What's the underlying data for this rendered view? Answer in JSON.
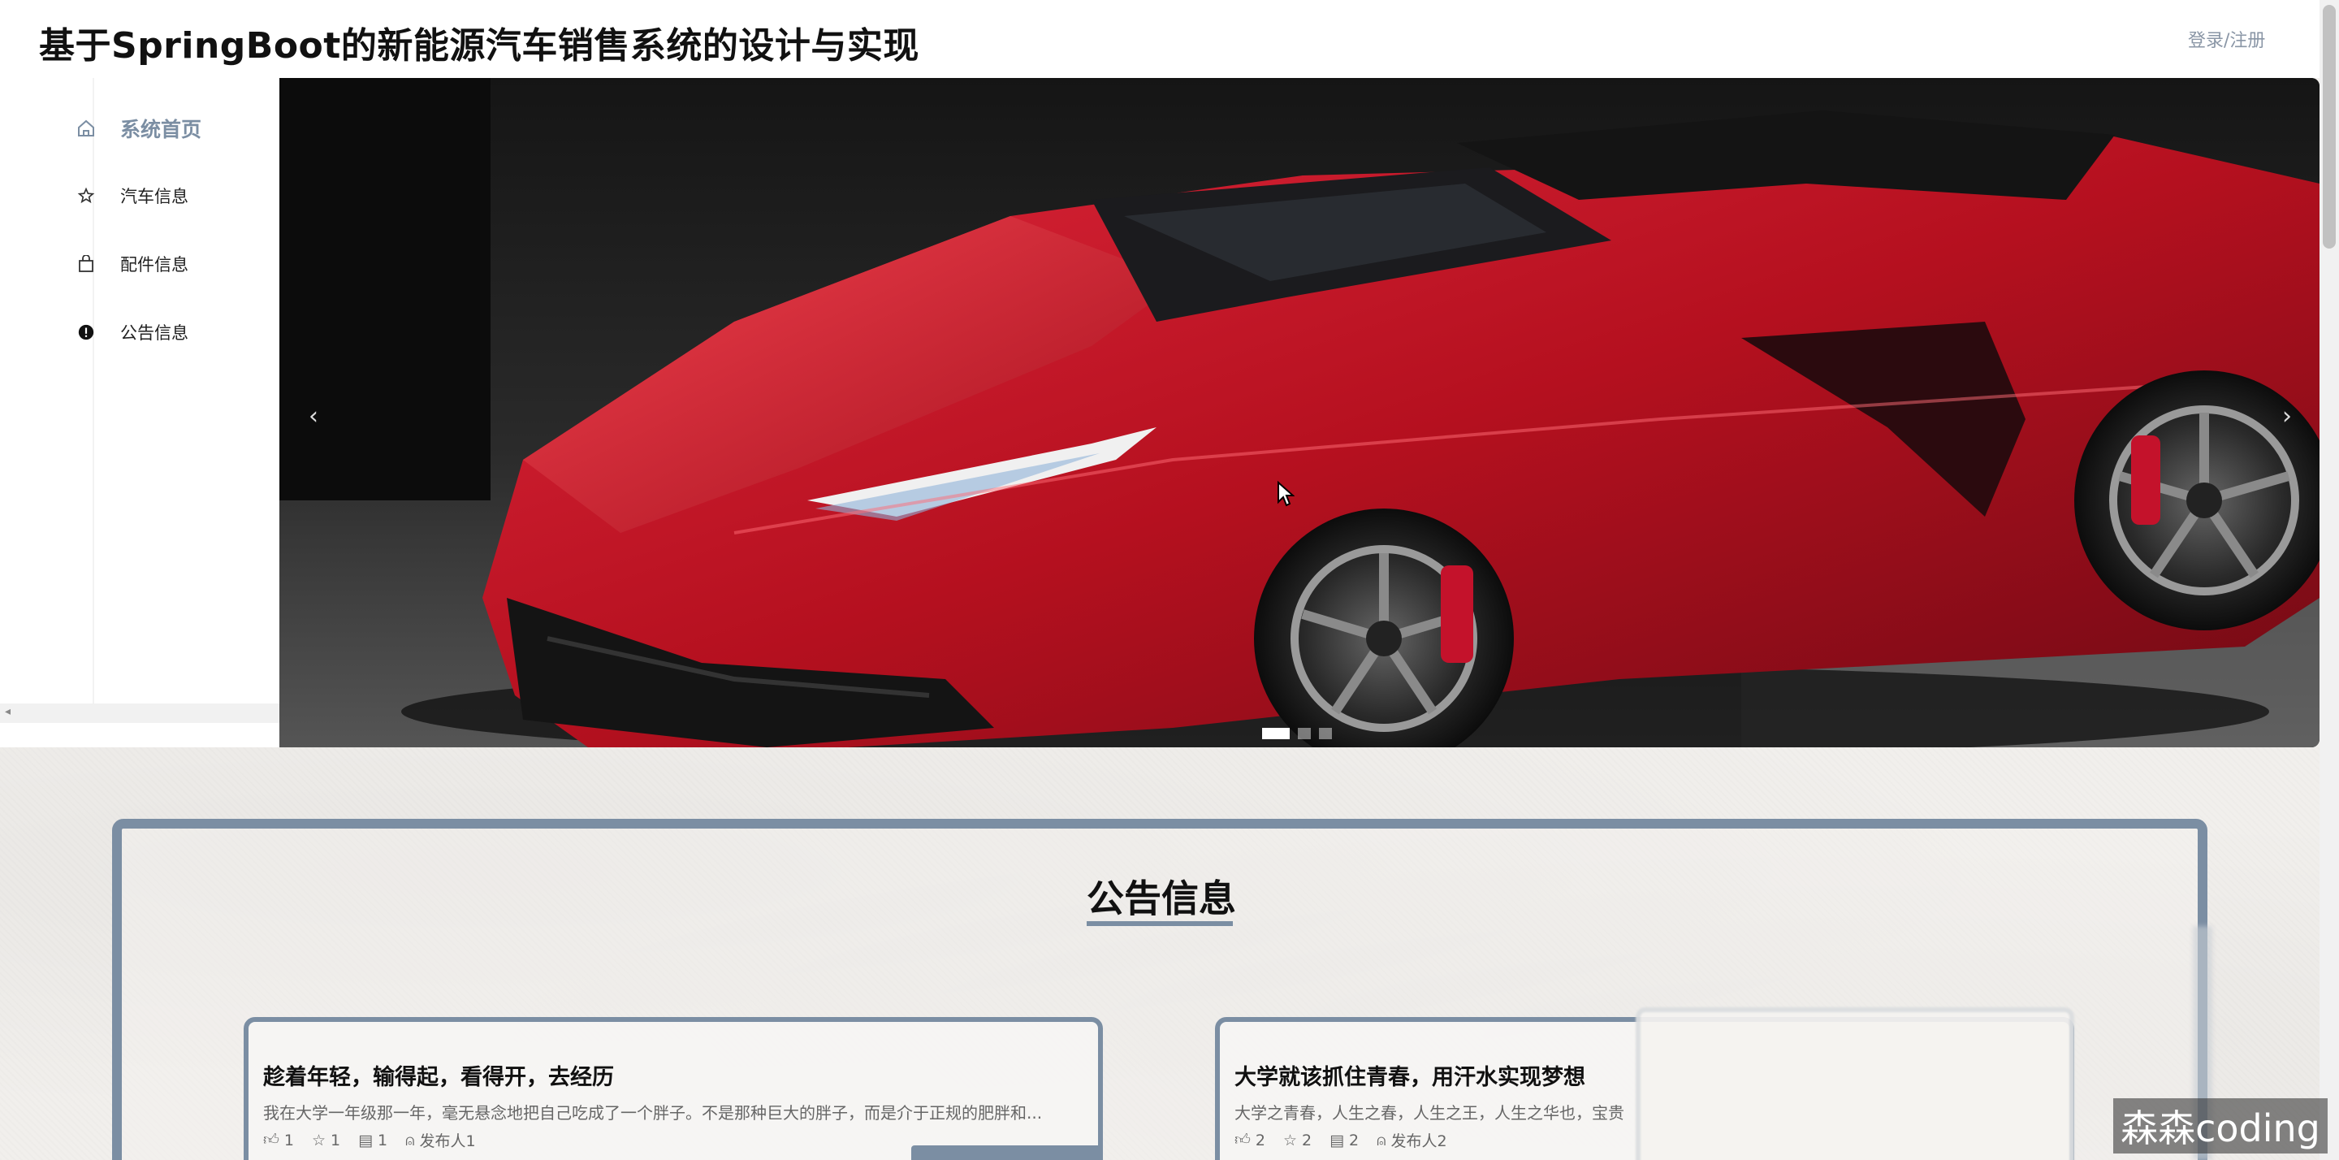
{
  "header": {
    "title": "基于SpringBoot的新能源汽车销售系统的设计与实现",
    "login_label": "登录/注册"
  },
  "sidebar": {
    "items": [
      {
        "label": "系统首页",
        "icon": "home-icon",
        "active": true
      },
      {
        "label": "汽车信息",
        "icon": "star-icon",
        "active": false
      },
      {
        "label": "配件信息",
        "icon": "bag-icon",
        "active": false
      },
      {
        "label": "公告信息",
        "icon": "info-icon",
        "active": false
      }
    ]
  },
  "carousel": {
    "slide_count": 3,
    "active_index": 0,
    "prev_label": "‹",
    "next_label": "›"
  },
  "notice": {
    "title": "公告信息",
    "cards": [
      {
        "title": "趁着年轻，输得起，看得开，去经历",
        "excerpt": "我在大学一年级那一年，毫无悬念地把自己吃成了一个胖子。不是那种巨大的胖子，而是介于正规的肥胖和...",
        "likes": "1",
        "stars": "1",
        "comments": "1",
        "publisher": "发布人1"
      },
      {
        "title": "大学就该抓住青春，用汗水实现梦想",
        "excerpt": "大学之青春，人生之春，人生之王，人生之华也，宝贵",
        "likes": "2",
        "stars": "2",
        "comments": "2",
        "publisher": "发布人2"
      }
    ]
  },
  "watermark": "森森coding",
  "colors": {
    "accent": "#7b8ea3",
    "car_red": "#c4122b",
    "background": "#f1efec"
  }
}
